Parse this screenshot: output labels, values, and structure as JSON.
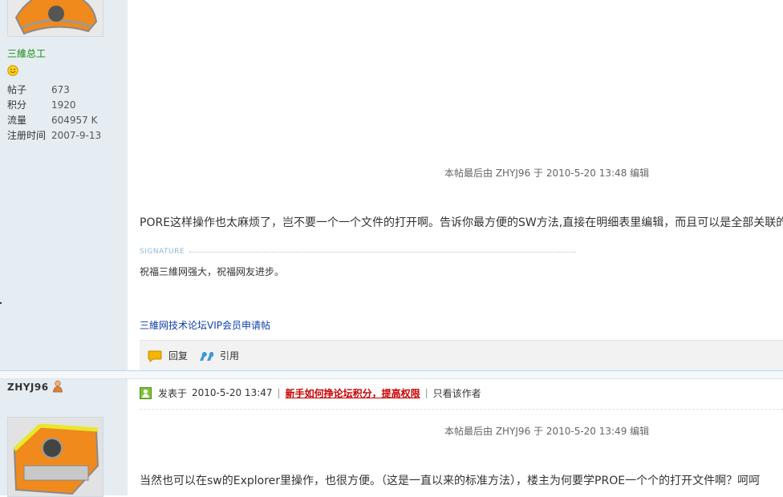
{
  "post1": {
    "user_group": "三維总工",
    "stats": [
      {
        "key": "帖子",
        "value": "673"
      },
      {
        "key": "积分",
        "value": "1920"
      },
      {
        "key": "流量",
        "value": "604957 K"
      },
      {
        "key": "注册时间",
        "value": "2007-9-13"
      }
    ],
    "edit_note": "本帖最后由 ZHYJ96 于 2010-5-20 13:48 编辑",
    "body": "PORE这样操作也太麻烦了，岂不要一个一个文件的打开啊。告诉你最方便的SW方法,直接在明细表里编辑，而且可以是全部关联的",
    "signature_label": "SIGNATURE",
    "signature_text": "祝福三維网强大，祝福网友进步。",
    "vip_link": "三維网技术论坛VIP会员申请帖",
    "actions": {
      "reply": "回复",
      "quote": "引用"
    }
  },
  "post2": {
    "username": "ZHYJ96",
    "posted_prefix": "发表于",
    "posted_time": "2010-5-20 13:47",
    "hot_link": "新手如何挣论坛积分，提高权限",
    "only_author": "只看该作者",
    "edit_note": "本帖最后由 ZHYJ96 于 2010-5-20 13:49 编辑",
    "body": "当然也可以在sw的Explorer里操作，也很方便。（这是一直以来的标准方法），楼主为何要学PROE一个个的打开文件啊？呵呵"
  },
  "colors": {
    "sidebar_bg": "#e5edf2",
    "group_green": "#1a8a16",
    "link_blue": "#0e3ea8",
    "hot_red": "#c90000"
  }
}
